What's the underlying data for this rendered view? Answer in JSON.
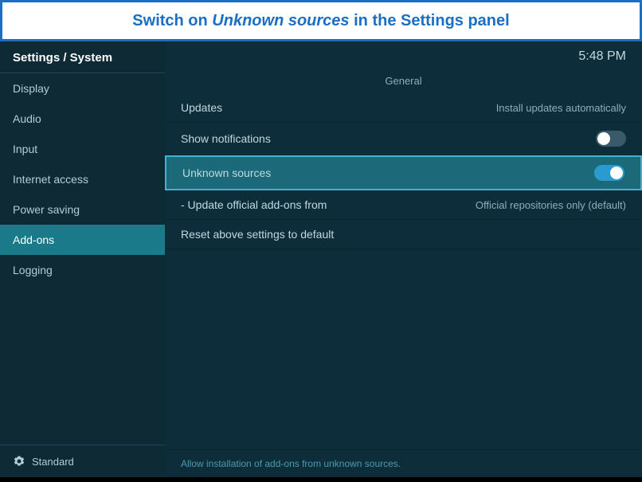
{
  "banner": {
    "text_before": "Switch on ",
    "text_italic": "Unknown sources",
    "text_after": " in the Settings panel"
  },
  "header": {
    "title": "Settings / System",
    "time": "5:48 PM"
  },
  "sidebar": {
    "items": [
      {
        "id": "display",
        "label": "Display",
        "active": false
      },
      {
        "id": "audio",
        "label": "Audio",
        "active": false
      },
      {
        "id": "input",
        "label": "Input",
        "active": false
      },
      {
        "id": "internet-access",
        "label": "Internet access",
        "active": false
      },
      {
        "id": "power-saving",
        "label": "Power saving",
        "active": false
      },
      {
        "id": "add-ons",
        "label": "Add-ons",
        "active": true
      },
      {
        "id": "logging",
        "label": "Logging",
        "active": false
      }
    ],
    "footer_label": "Standard"
  },
  "content": {
    "section_label": "General",
    "rows": [
      {
        "id": "updates",
        "label": "Updates",
        "value": "Install updates automatically",
        "toggle": null,
        "highlighted": false
      },
      {
        "id": "show-notifications",
        "label": "Show notifications",
        "value": null,
        "toggle": "off",
        "highlighted": false
      },
      {
        "id": "unknown-sources",
        "label": "Unknown sources",
        "value": null,
        "toggle": "on",
        "highlighted": true
      },
      {
        "id": "update-official-addons",
        "label": "- Update official add-ons from",
        "value": "Official repositories only (default)",
        "toggle": null,
        "highlighted": false
      },
      {
        "id": "reset-settings",
        "label": "Reset above settings to default",
        "value": null,
        "toggle": null,
        "highlighted": false
      }
    ],
    "hint": "Allow installation of add-ons from unknown sources."
  }
}
